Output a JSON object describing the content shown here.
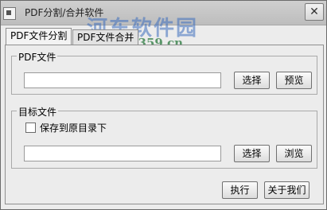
{
  "window": {
    "title": "PDF分割/合并软件",
    "close_glyph": "✕",
    "app_icon": "app-icon"
  },
  "tabs": [
    {
      "label": "PDF文件分割",
      "active": true
    },
    {
      "label": "PDF文件合并",
      "active": false
    }
  ],
  "pdf_file_group": {
    "legend": "PDF文件",
    "path_value": "",
    "select_label": "选择",
    "preview_label": "预览"
  },
  "target_group": {
    "legend": "目标文件",
    "save_to_original_label": "保存到原目录下",
    "save_to_original_checked": false,
    "path_value": "",
    "select_label": "选择",
    "browse_label": "浏览"
  },
  "footer": {
    "execute_label": "执行",
    "about_label": "关于我们"
  },
  "watermark": {
    "site_name": "河东软件园",
    "url": "www.pc0359.cn"
  }
}
